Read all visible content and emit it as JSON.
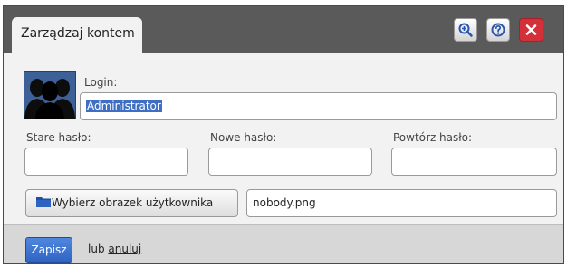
{
  "dialog": {
    "title": "Zarządzaj kontem",
    "zoom_icon": "zoom-in-icon",
    "help_icon": "help-icon",
    "close_icon": "close-icon",
    "close_color": "#d3303a"
  },
  "form": {
    "login_label": "Login:",
    "login_value": "Administrator",
    "old_password_label": "Stare hasło:",
    "new_password_label": "Nowe hasło:",
    "repeat_password_label": "Powtórz hasło:",
    "choose_image_label": "Wybierz obrazek użytkownika",
    "image_filename": "nobody.png"
  },
  "footer": {
    "save_label": "Zapisz",
    "or_text": "lub",
    "cancel_label": "anuluj"
  }
}
